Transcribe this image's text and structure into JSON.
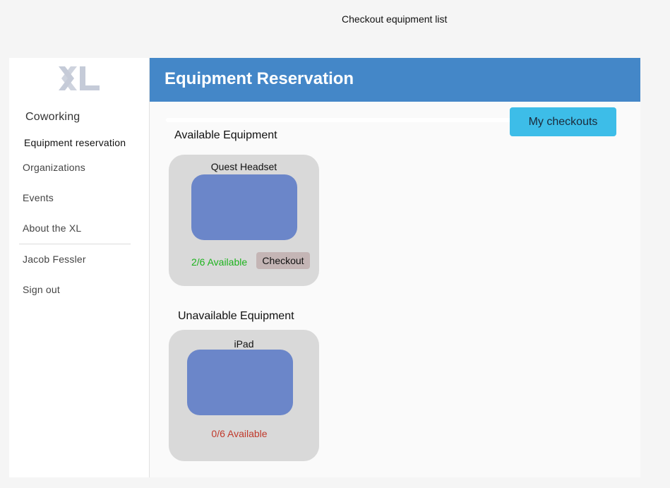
{
  "canvas": {
    "title": "Checkout equipment list"
  },
  "sidebar": {
    "logo_text": "XL",
    "items": [
      {
        "label": "Coworking"
      },
      {
        "label": "Equipment reservation"
      },
      {
        "label": "Organizations"
      },
      {
        "label": "Events"
      },
      {
        "label": "About the XL"
      },
      {
        "label": "Jacob Fessler"
      },
      {
        "label": "Sign out"
      }
    ]
  },
  "header": {
    "title": "Equipment Reservation"
  },
  "main": {
    "my_checkouts_label": "My checkouts",
    "available": {
      "title": "Available Equipment",
      "items": [
        {
          "name": "Quest Headset",
          "availability": "2/6 Available",
          "checkout_label": "Checkout"
        }
      ]
    },
    "unavailable": {
      "title": "Unavailable Equipment",
      "items": [
        {
          "name": "iPad",
          "availability": "0/6 Available"
        }
      ]
    }
  },
  "colors": {
    "header": "#4487c8",
    "my_checkouts": "#3dbde8",
    "card": "#d9d9d9",
    "card_image": "#6b86c9",
    "available_text": "#1db31d",
    "unavailable_text": "#c0392b",
    "checkout_button": "#c4b5b5"
  }
}
